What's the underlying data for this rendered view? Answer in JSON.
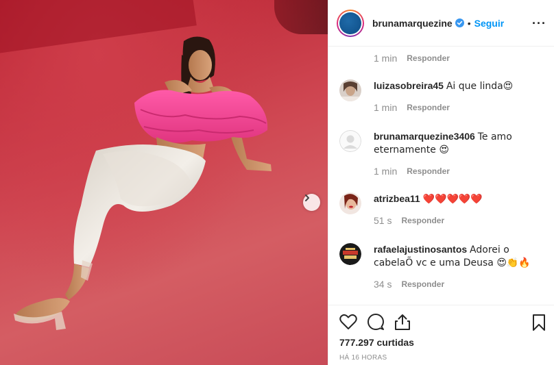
{
  "post": {
    "image_alt": "Woman in pink ruffled top and sequined silver pants seated on a red carpet"
  },
  "header": {
    "username": "brunamarquezine",
    "separator": "•",
    "follow_label": "Seguir",
    "more_label": "···"
  },
  "first_comment_meta": {
    "time": "1 min",
    "reply_label": "Responder"
  },
  "comments": [
    {
      "user": "luizasobreira45",
      "text": "Ai que linda😍",
      "time": "1 min",
      "reply_label": "Responder"
    },
    {
      "user": "brunamarquezine3406",
      "text": "Te amo eternamente 😍",
      "time": "1 min",
      "reply_label": "Responder"
    },
    {
      "user": "atrizbea11",
      "text": "❤️❤️❤️❤️❤️",
      "time": "51 s",
      "reply_label": "Responder"
    },
    {
      "user": "rafaelajustinosantos",
      "text": "Adorei o cabelaÕ vc e uma Deusa 😍👏🔥",
      "time": "34 s",
      "reply_label": "Responder"
    }
  ],
  "footer": {
    "likes": "777.297 curtidas",
    "time_ago": "HÁ 16 HORAS"
  },
  "icons": {
    "like": "heart-icon",
    "comment": "comment-icon",
    "share": "share-icon",
    "save": "bookmark-icon",
    "next": "chevron-right-icon",
    "verified": "verified-badge-icon",
    "more": "more-options-icon"
  },
  "colors": {
    "accent": "#0095f6",
    "text": "#262626",
    "secondary": "#8e8e8e",
    "border": "#efefef"
  }
}
